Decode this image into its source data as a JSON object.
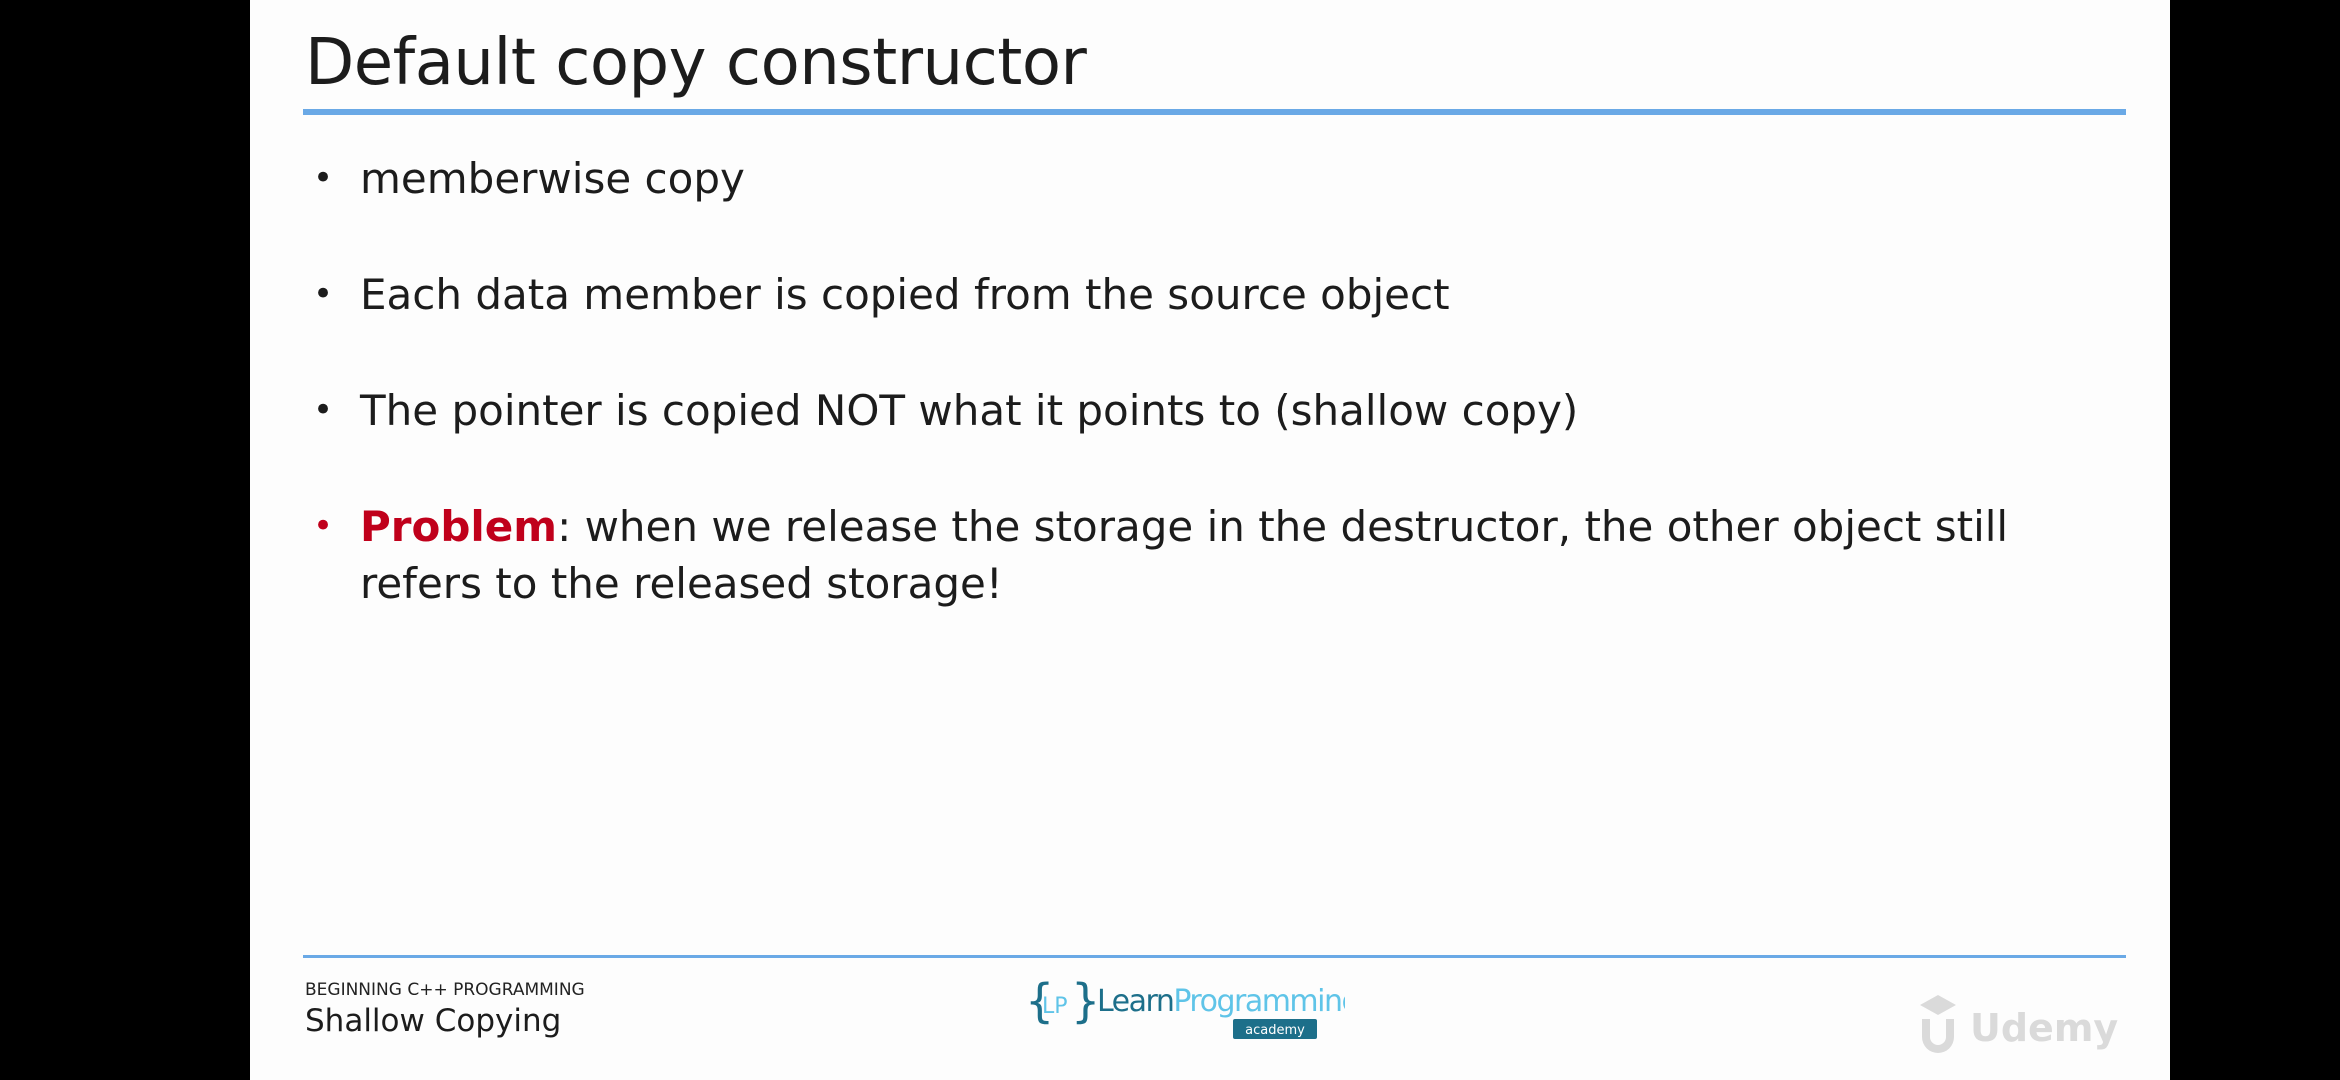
{
  "slide": {
    "title": "Default copy constructor",
    "bullets": [
      {
        "text": "memberwise copy"
      },
      {
        "text": "Each data member is copied from the source object"
      },
      {
        "text": "The pointer is copied NOT what it points to (shallow copy)"
      },
      {
        "highlight": "Problem",
        "text": ": when we release the storage in the destructor, the other object still refers to the released storage!"
      }
    ],
    "bullet_glyph": "•"
  },
  "footer": {
    "course": "BEGINNING C++ PROGRAMMING",
    "lecture": "Shallow Copying"
  },
  "logo": {
    "icon": "lp-brace-logo-icon",
    "word_learn": "Learn",
    "word_programming": "Programming",
    "badge": "academy"
  },
  "watermark": {
    "icon": "udemy-logo-icon",
    "text": "Udemy"
  },
  "colors": {
    "accent_rule": "#6aa9e6",
    "problem_red": "#c0001b",
    "logo_teal": "#1d6f8a",
    "logo_cyan": "#5fc4e8"
  }
}
